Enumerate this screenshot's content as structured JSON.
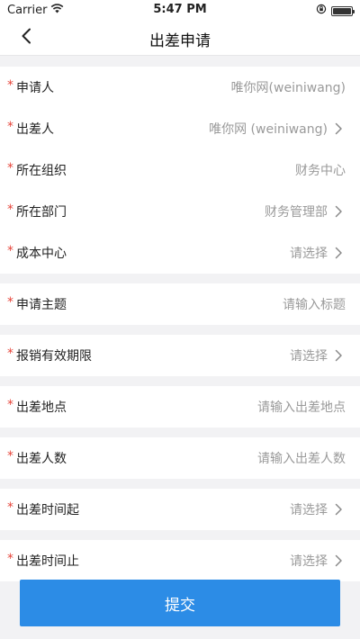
{
  "status_bar": {
    "carrier": "Carrier",
    "time": "5:47 PM",
    "battery_level": 1.0
  },
  "nav": {
    "title": "出差申请",
    "back_icon": "chevron-left-icon"
  },
  "form": {
    "required_mark": "*",
    "rows": [
      {
        "label": "申请人",
        "value": "唯你网(weiniwang)",
        "chevron": false
      },
      {
        "label": "出差人",
        "value": "唯你网 (weiniwang)",
        "chevron": true
      },
      {
        "label": "所在组织",
        "value": "财务中心",
        "chevron": false
      },
      {
        "label": "所在部门",
        "value": "财务管理部",
        "chevron": true
      },
      {
        "label": "成本中心",
        "value": "请选择",
        "chevron": true
      },
      {
        "label": "申请主题",
        "value": "请输入标题",
        "chevron": false
      },
      {
        "label": "报销有效期限",
        "value": "请选择",
        "chevron": true
      },
      {
        "label": "出差地点",
        "value": "请输入出差地点",
        "chevron": false
      },
      {
        "label": "出差人数",
        "value": "请输入出差人数",
        "chevron": false
      },
      {
        "label": "出差时间起",
        "value": "请选择",
        "chevron": true
      },
      {
        "label": "出差时间止",
        "value": "请选择",
        "chevron": true
      }
    ]
  },
  "submit": {
    "label": "提交",
    "color": "#2c8ce6"
  },
  "colors": {
    "required": "#e6453a",
    "placeholder": "#9a9a9a",
    "background": "#f2f2f4"
  }
}
